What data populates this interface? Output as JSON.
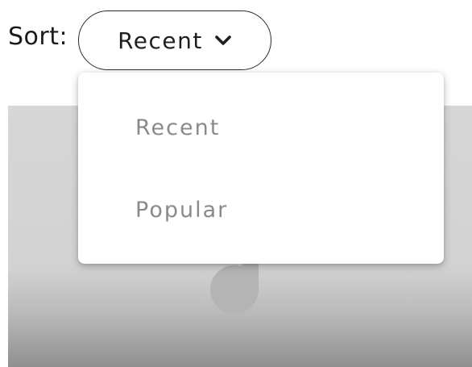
{
  "sort": {
    "label": "Sort:",
    "selected": "Recent",
    "chevron_icon": "chevron-down-icon"
  },
  "dropdown": {
    "options": [
      {
        "label": "Recent"
      },
      {
        "label": "Popular"
      }
    ]
  },
  "colors": {
    "text_dark": "#1a1a1a",
    "option_text": "#8a8a8a",
    "card_bg": "#d2d2d2"
  }
}
